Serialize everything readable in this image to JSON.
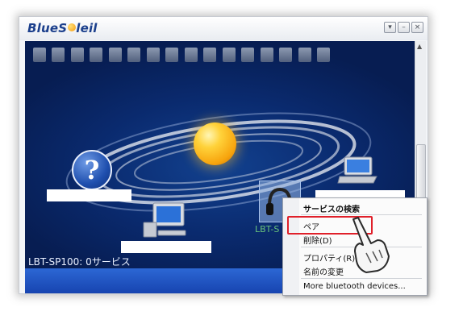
{
  "app": {
    "logo_text": "BlueSoleil",
    "logo_prefix": "Blue",
    "logo_suffix": "leil"
  },
  "window_controls": {
    "minimize": "–",
    "restore": "▭",
    "close": "×",
    "dropdown": "▾"
  },
  "devices": [
    {
      "name": "unknown-device",
      "label": ""
    },
    {
      "name": "desktop-pc",
      "label": ""
    },
    {
      "name": "laptop",
      "label": ""
    },
    {
      "name": "headset",
      "label": "LBT-SP100"
    }
  ],
  "headset_label_visible": "LBT-S",
  "status": {
    "text": "LBT-SP100: 0サービス"
  },
  "context_menu": {
    "header": "サービスの検索",
    "items": [
      "ペア",
      "削除(D)",
      "プロパティ(R)",
      "名前の変更"
    ],
    "footer": "More bluetooth devices..."
  },
  "colors": {
    "canvas_bg": "#0a2a6e",
    "highlight": "#e0202a",
    "status_text": "#e9f0ff",
    "device_label": "#69c27b"
  }
}
